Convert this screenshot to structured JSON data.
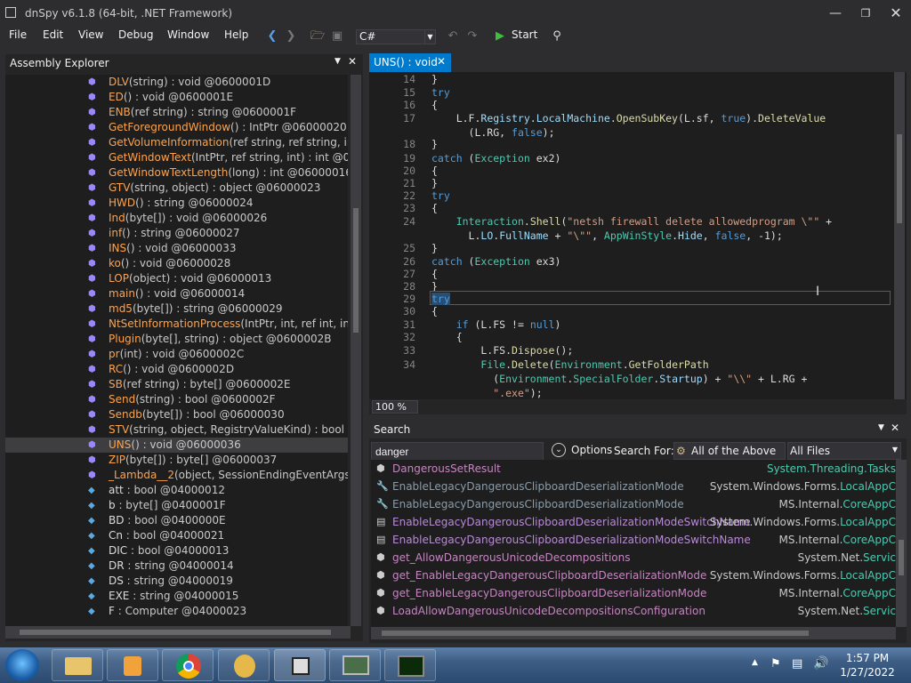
{
  "window": {
    "title": "dnSpy v6.1.8 (64-bit, .NET Framework)"
  },
  "menu": [
    "File",
    "Edit",
    "View",
    "Debug",
    "Window",
    "Help"
  ],
  "toolbar": {
    "language": "C#",
    "start_label": "Start"
  },
  "assembly_explorer": {
    "title": "Assembly Explorer",
    "items": [
      {
        "name": "DLV",
        "sig": "(string) : void @0600001D",
        "kind": "method"
      },
      {
        "name": "ED",
        "sig": "() : void @0600001E",
        "kind": "method"
      },
      {
        "name": "ENB",
        "sig": "(ref string) : string @0600001F",
        "kind": "method"
      },
      {
        "name": "GetForegroundWindow",
        "sig": "() : IntPtr @06000020",
        "kind": "method"
      },
      {
        "name": "GetVolumeInformation",
        "sig": "(ref string, ref string, int, ref",
        "kind": "method"
      },
      {
        "name": "GetWindowText",
        "sig": "(IntPtr, ref string, int) : int @0600002",
        "kind": "method"
      },
      {
        "name": "GetWindowTextLength",
        "sig": "(long) : int @06000016",
        "kind": "method"
      },
      {
        "name": "GTV",
        "sig": "(string, object) : object @06000023",
        "kind": "method"
      },
      {
        "name": "HWD",
        "sig": "() : string @06000024",
        "kind": "method"
      },
      {
        "name": "Ind",
        "sig": "(byte[]) : void @06000026",
        "kind": "method"
      },
      {
        "name": "inf",
        "sig": "() : string @06000027",
        "kind": "method"
      },
      {
        "name": "INS",
        "sig": "() : void @06000033",
        "kind": "method"
      },
      {
        "name": "ko",
        "sig": "() : void @06000028",
        "kind": "method"
      },
      {
        "name": "LOP",
        "sig": "(object) : void @06000013",
        "kind": "method"
      },
      {
        "name": "main",
        "sig": "() : void @06000014",
        "kind": "method"
      },
      {
        "name": "md5",
        "sig": "(byte[]) : string @06000029",
        "kind": "method"
      },
      {
        "name": "NtSetInformationProcess",
        "sig": "(IntPtr, int, ref int, int) : int",
        "kind": "method"
      },
      {
        "name": "Plugin",
        "sig": "(byte[], string) : object @0600002B",
        "kind": "method"
      },
      {
        "name": "pr",
        "sig": "(int) : void @0600002C",
        "kind": "method"
      },
      {
        "name": "RC",
        "sig": "() : void @0600002D",
        "kind": "method"
      },
      {
        "name": "SB",
        "sig": "(ref string) : byte[] @0600002E",
        "kind": "method"
      },
      {
        "name": "Send",
        "sig": "(string) : bool @0600002F",
        "kind": "method"
      },
      {
        "name": "Sendb",
        "sig": "(byte[]) : bool @06000030",
        "kind": "method"
      },
      {
        "name": "STV",
        "sig": "(string, object, RegistryValueKind) : bool @0600",
        "kind": "method"
      },
      {
        "name": "UNS",
        "sig": "() : void @06000036",
        "kind": "method",
        "selected": true
      },
      {
        "name": "ZIP",
        "sig": "(byte[]) : byte[] @06000037",
        "kind": "method"
      },
      {
        "name": "_Lambda__2",
        "sig": "(object, SessionEndingEventArgs) : voic",
        "kind": "method"
      },
      {
        "name": "att",
        "sig": " : bool @04000012",
        "kind": "field"
      },
      {
        "name": "b",
        "sig": " : byte[] @0400001F",
        "kind": "field"
      },
      {
        "name": "BD",
        "sig": " : bool @0400000E",
        "kind": "field"
      },
      {
        "name": "Cn",
        "sig": " : bool @04000021",
        "kind": "field"
      },
      {
        "name": "DIC",
        "sig": " : bool @04000013",
        "kind": "field"
      },
      {
        "name": "DR",
        "sig": " : string @04000014",
        "kind": "field"
      },
      {
        "name": "DS",
        "sig": " : string @04000019",
        "kind": "field"
      },
      {
        "name": "EXE",
        "sig": " : string @04000015",
        "kind": "field"
      },
      {
        "name": "F",
        "sig": " : Computer @04000023",
        "kind": "field"
      }
    ]
  },
  "editor": {
    "tab_label": "UNS() : void",
    "zoom": "100 %",
    "line_numbers": [
      "14",
      "15",
      "16",
      "17",
      "",
      "18",
      "19",
      "20",
      "21",
      "22",
      "23",
      "24",
      "",
      "25",
      "26",
      "27",
      "28",
      "29",
      "30",
      "31",
      "32",
      "33",
      "34",
      "",
      ""
    ]
  },
  "search": {
    "title": "Search",
    "query": "danger",
    "options_label": "Options",
    "search_for_label": "Search For:",
    "search_for_value": "All of the Above",
    "scope_value": "All Files",
    "results": [
      {
        "name": "DangerousSetResult",
        "icon": "method-icon",
        "ns": "",
        "cls": "System.Threading.Tasks",
        "color": "purple"
      },
      {
        "name": "EnableLegacyDangerousClipboardDeserializationMode",
        "icon": "wrench-icon",
        "ns": "System.Windows.Forms.",
        "cls": "LocalAppC",
        "color": "slate"
      },
      {
        "name": "EnableLegacyDangerousClipboardDeserializationMode",
        "icon": "wrench-icon",
        "ns": "MS.Internal.",
        "cls": "CoreAppC",
        "color": "slate"
      },
      {
        "name": "EnableLegacyDangerousClipboardDeserializationModeSwitchName",
        "icon": "field-icon",
        "ns": "System.Windows.Forms.",
        "cls": "LocalAppC",
        "color": "lav"
      },
      {
        "name": "EnableLegacyDangerousClipboardDeserializationModeSwitchName",
        "icon": "field-icon",
        "ns": "MS.Internal.",
        "cls": "CoreAppC",
        "color": "lav"
      },
      {
        "name": "get_AllowDangerousUnicodeDecompositions",
        "icon": "method-icon",
        "ns": "System.Net.",
        "cls": "Servic",
        "color": "purple"
      },
      {
        "name": "get_EnableLegacyDangerousClipboardDeserializationMode",
        "icon": "method-icon",
        "ns": "System.Windows.Forms.",
        "cls": "LocalAppC",
        "color": "purple"
      },
      {
        "name": "get_EnableLegacyDangerousClipboardDeserializationMode",
        "icon": "method-icon",
        "ns": "MS.Internal.",
        "cls": "CoreAppC",
        "color": "purple"
      },
      {
        "name": "LoadAllowDangerousUnicodeDecompositionsConfiguration",
        "icon": "method-icon",
        "ns": "System.Net.",
        "cls": "Servic",
        "color": "purple"
      }
    ]
  },
  "taskbar": {
    "time": "1:57 PM",
    "date": "1/27/2022"
  }
}
